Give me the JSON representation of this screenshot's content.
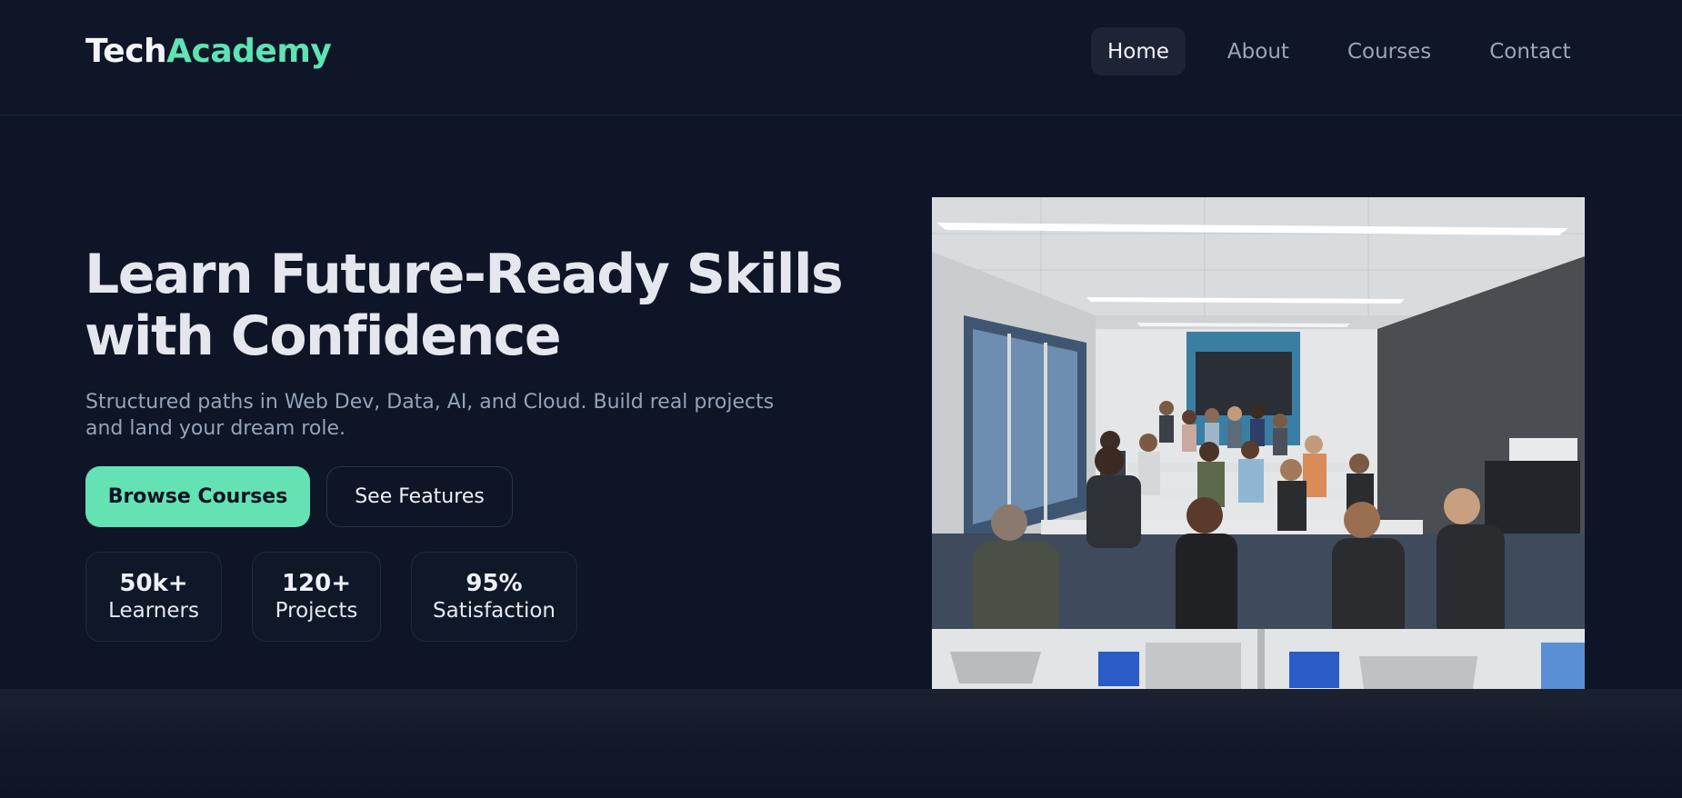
{
  "header": {
    "brand_part1": "Tech",
    "brand_part2": "Academy",
    "nav": [
      {
        "label": "Home",
        "active": true
      },
      {
        "label": "About",
        "active": false
      },
      {
        "label": "Courses",
        "active": false
      },
      {
        "label": "Contact",
        "active": false
      }
    ]
  },
  "hero": {
    "title_line1": "Learn Future-Ready Skills",
    "title_line2": "with Confidence",
    "subtitle_line1": "Structured paths in Web Dev, Data, AI, and Cloud. Build real projects",
    "subtitle_line2": "and land your dream role.",
    "primary_button": "Browse Courses",
    "secondary_button": "See Features",
    "stats": [
      {
        "value": "50k+",
        "label": "Learners"
      },
      {
        "value": "120+",
        "label": "Projects"
      },
      {
        "value": "95%",
        "label": "Satisfaction"
      }
    ],
    "image_subject": "classroom-photo"
  },
  "colors": {
    "background": "#0d1526",
    "accent": "#64e2b3",
    "brand_accent": "#5fe3b3",
    "muted_text": "#95a3ba",
    "nav_active_bg": "#1c2436"
  }
}
